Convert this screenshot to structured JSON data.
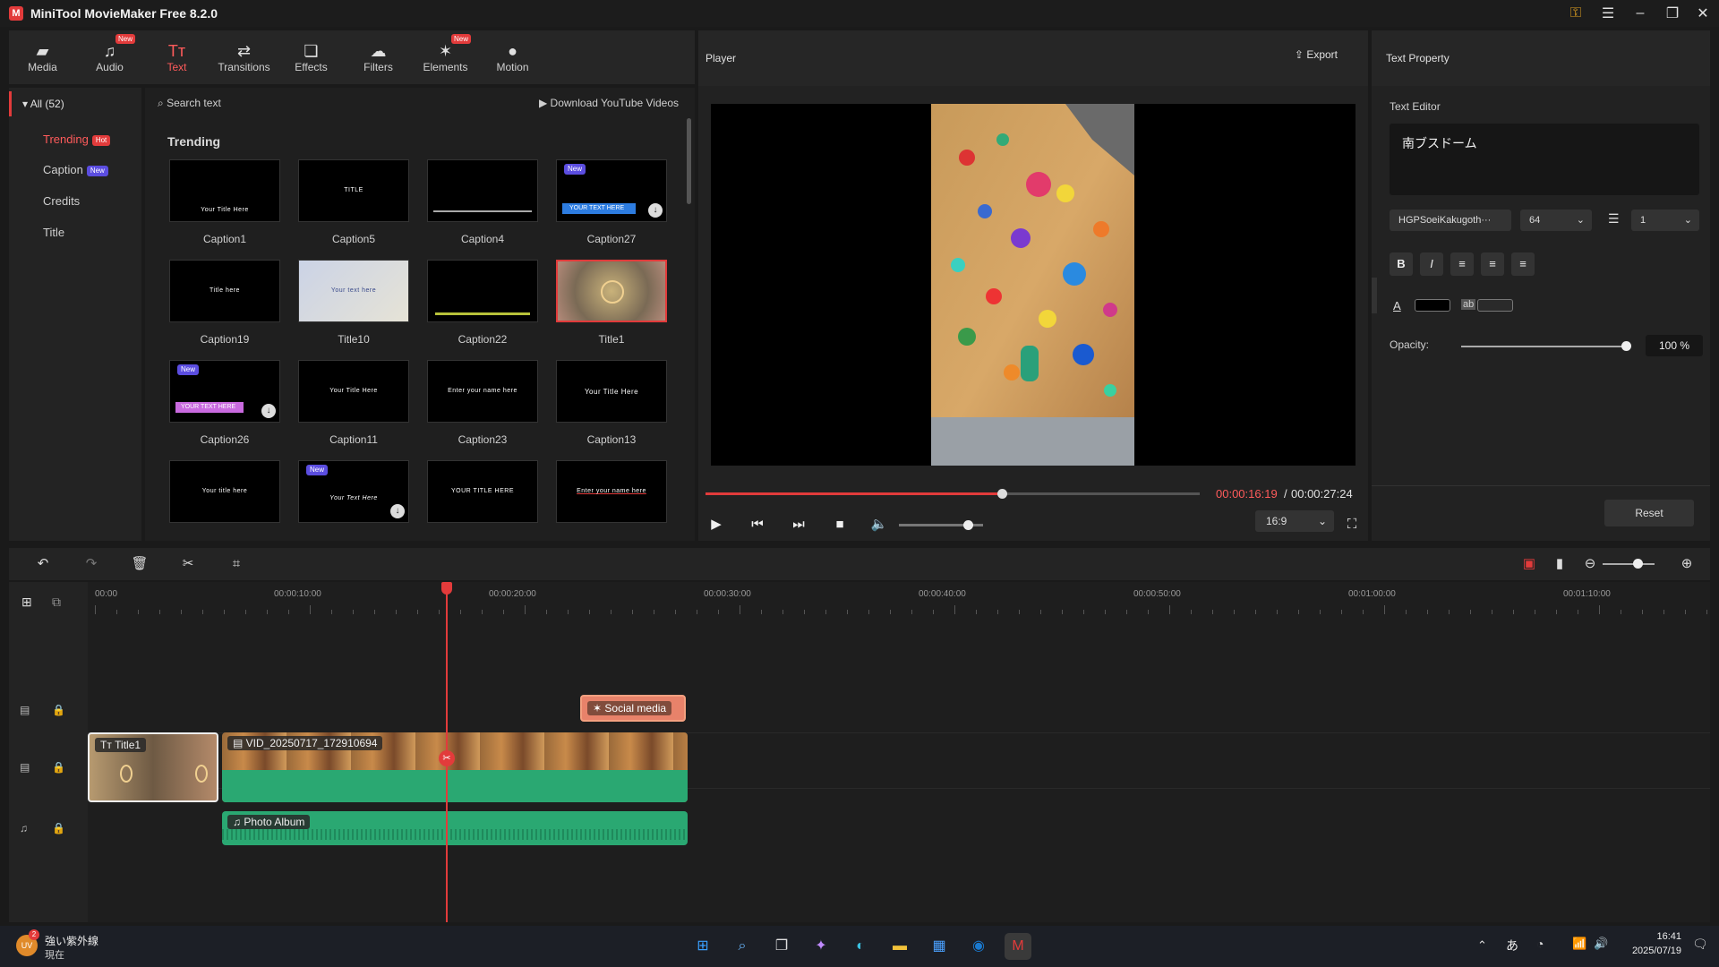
{
  "window": {
    "title": "MiniTool MovieMaker Free 8.2.0"
  },
  "toolbar": {
    "items": [
      {
        "label": "Media",
        "badge": ""
      },
      {
        "label": "Audio",
        "badge": "New"
      },
      {
        "label": "Text",
        "badge": ""
      },
      {
        "label": "Transitions",
        "badge": ""
      },
      {
        "label": "Effects",
        "badge": ""
      },
      {
        "label": "Filters",
        "badge": ""
      },
      {
        "label": "Elements",
        "badge": "New"
      },
      {
        "label": "Motion",
        "badge": ""
      }
    ],
    "active": "Text"
  },
  "categories": {
    "all": "All (52)",
    "items": [
      {
        "label": "Trending",
        "badge": "Hot"
      },
      {
        "label": "Caption",
        "badge": "New"
      },
      {
        "label": "Credits",
        "badge": ""
      },
      {
        "label": "Title",
        "badge": ""
      }
    ]
  },
  "library": {
    "search_placeholder": "Search text",
    "download_label": "Download YouTube Videos",
    "section": "Trending",
    "thumbs": [
      {
        "label": "Caption1",
        "preview": "Your Title Here"
      },
      {
        "label": "Caption5",
        "preview": "TITLE"
      },
      {
        "label": "Caption4",
        "preview": ""
      },
      {
        "label": "Caption27",
        "preview": "YOUR TEXT HERE"
      },
      {
        "label": "Caption19",
        "preview": "Title here"
      },
      {
        "label": "Title10",
        "preview": "Your text here"
      },
      {
        "label": "Caption22",
        "preview": ""
      },
      {
        "label": "Title1",
        "preview": ""
      },
      {
        "label": "Caption26",
        "preview": "YOUR TEXT HERE"
      },
      {
        "label": "Caption11",
        "preview": "Your Title Here"
      },
      {
        "label": "Caption23",
        "preview": "Enter your name here"
      },
      {
        "label": "Caption13",
        "preview": "Your Title Here"
      },
      {
        "label": "",
        "preview": "Your title here"
      },
      {
        "label": "",
        "preview": "Your Text Here"
      },
      {
        "label": "",
        "preview": "YOUR TITLE HERE"
      },
      {
        "label": "",
        "preview": "Enter your name here"
      }
    ],
    "new_badge": "New"
  },
  "player": {
    "label": "Player",
    "export_label": "Export",
    "time_current": "00:00:16:19",
    "time_separator": " / ",
    "time_total": "00:00:27:24",
    "progress": 0.6,
    "volume": 0.82,
    "ratio": "16:9"
  },
  "properties": {
    "title": "Text Property",
    "editor_label": "Text Editor",
    "text": "南ブスドーム",
    "font": "HGPSoeiKakugoth···",
    "size": "64",
    "line_spacing": "1",
    "opacity_label": "Opacity:",
    "opacity_value": "100 %",
    "opacity": 1.0,
    "reset_label": "Reset"
  },
  "timeline": {
    "ruler_labels": [
      "00:00",
      "00:00:10:00",
      "00:00:20:00",
      "00:00:30:00",
      "00:00:40:00",
      "00:00:50:00",
      "00:01:00:00",
      "00:01:10:00"
    ],
    "clips": {
      "title": "Title1",
      "video": "VID_20250717_172910694",
      "sticker": "Social media",
      "audio": "Photo Album"
    }
  },
  "taskbar": {
    "weather_title": "強い紫外線",
    "weather_sub": "現在",
    "weather_badge": "2",
    "ime": "あ",
    "time": "16:41",
    "date": "2025/07/19"
  },
  "colors": {
    "accent": "#e23b3b",
    "clip_audio": "#2aa872",
    "sticker": "#e8826a"
  }
}
